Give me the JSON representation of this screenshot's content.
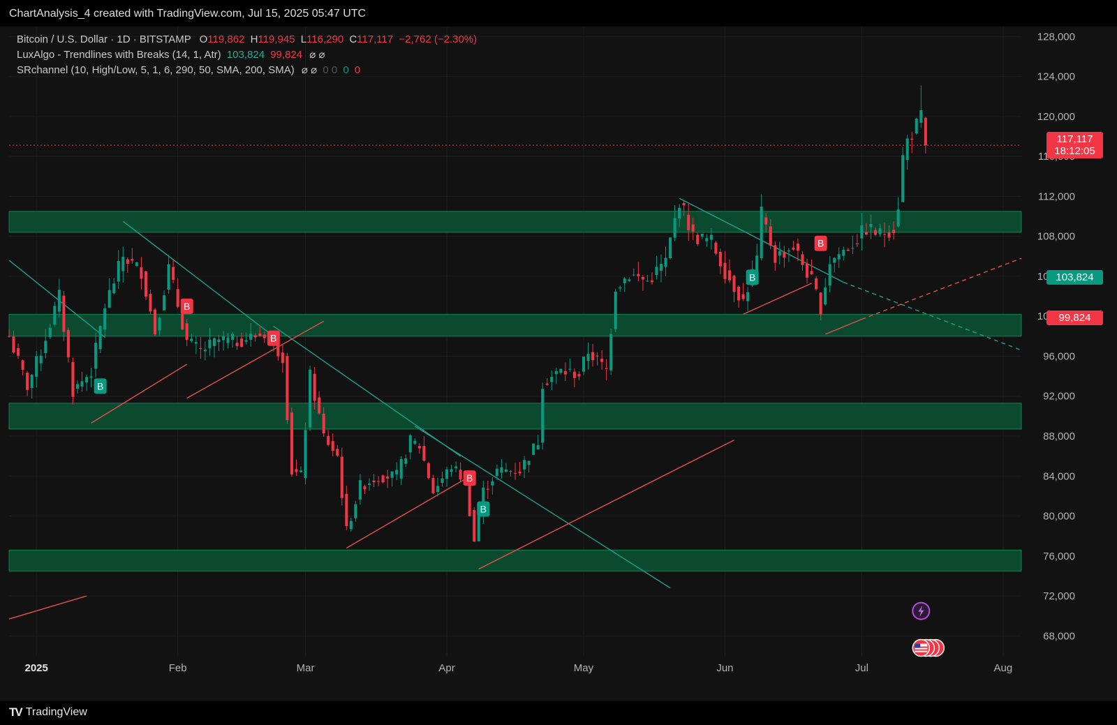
{
  "header": {
    "title": "ChartAnalysis_4 created with TradingView.com, Jul 15, 2025 05:47 UTC"
  },
  "legend": {
    "symbol": "Bitcoin / U.S. Dollar · 1D · BITSTAMP",
    "o_label": "O",
    "o_value": "119,862",
    "h_label": "H",
    "h_value": "119,945",
    "l_label": "L",
    "l_value": "116,290",
    "c_label": "C",
    "c_value": "117,117",
    "change": "−2,762 (−2.30%)",
    "indicator1_name": "LuxAlgo - Trendlines with Breaks (14, 1, Atr)",
    "indicator1_v1": "103,824",
    "indicator1_v2": "99,824",
    "indicator1_icons": "⌀ ⌀",
    "indicator2_name": "SRchannel (10, High/Low, 5, 1, 6, 290, 50, SMA, 200, SMA)",
    "indicator2_icons": "⌀ ⌀",
    "indicator2_dim": "0 0",
    "indicator2_v1": "0",
    "indicator2_v2": "0"
  },
  "price_tags": {
    "last_price": "117,117",
    "countdown": "18:12:05",
    "upper_trend": "103,824",
    "lower_trend": "99,824"
  },
  "footer": {
    "brand": "TradingView"
  },
  "colors": {
    "up": "#089981",
    "down": "#f23645",
    "zone": "#0b4a2e",
    "zone_border": "#16a36a",
    "trend_down": "#1f9e8e",
    "trend_up": "#e0524d",
    "grid": "#1e1e1e"
  },
  "chart_data": {
    "type": "candlestick",
    "title": "Bitcoin / U.S. Dollar · 1D · BITSTAMP",
    "ylim": [
      66000,
      129000
    ],
    "y_ticks": [
      "128,000",
      "124,000",
      "120,000",
      "116,000",
      "112,000",
      "108,000",
      "104,000",
      "100,000",
      "96,000",
      "92,000",
      "88,000",
      "84,000",
      "80,000",
      "76,000",
      "72,000",
      "68,000"
    ],
    "y_tick_values": [
      128000,
      124000,
      120000,
      116000,
      112000,
      108000,
      104000,
      100000,
      96000,
      92000,
      88000,
      84000,
      80000,
      76000,
      72000,
      68000
    ],
    "x_start_day": "2024-12-26",
    "x_end_day": "2025-08-05",
    "x_ticks": [
      {
        "label": "2025",
        "day": "2025-01-01",
        "bold": true
      },
      {
        "label": "Feb",
        "day": "2025-02-01"
      },
      {
        "label": "Mar",
        "day": "2025-03-01"
      },
      {
        "label": "Apr",
        "day": "2025-04-01"
      },
      {
        "label": "May",
        "day": "2025-05-01"
      },
      {
        "label": "Jun",
        "day": "2025-06-01"
      },
      {
        "label": "Jul",
        "day": "2025-07-01"
      },
      {
        "label": "Aug",
        "day": "2025-08-01"
      }
    ],
    "anchors": [
      [
        "2024-12-26",
        98000
      ],
      [
        "2024-12-30",
        93000
      ],
      [
        "2025-01-02",
        96500
      ],
      [
        "2025-01-06",
        102000
      ],
      [
        "2025-01-09",
        92500
      ],
      [
        "2025-01-13",
        94500
      ],
      [
        "2025-01-16",
        101000
      ],
      [
        "2025-01-20",
        106000
      ],
      [
        "2025-01-24",
        104500
      ],
      [
        "2025-01-27",
        98500
      ],
      [
        "2025-01-30",
        104800
      ],
      [
        "2025-02-03",
        97500
      ],
      [
        "2025-02-06",
        96500
      ],
      [
        "2025-02-10",
        97600
      ],
      [
        "2025-02-14",
        97500
      ],
      [
        "2025-02-20",
        98300
      ],
      [
        "2025-02-24",
        96000
      ],
      [
        "2025-02-26",
        84500
      ],
      [
        "2025-02-28",
        84000
      ],
      [
        "2025-03-02",
        94000
      ],
      [
        "2025-03-05",
        88000
      ],
      [
        "2025-03-08",
        86000
      ],
      [
        "2025-03-10",
        78500
      ],
      [
        "2025-03-13",
        83000
      ],
      [
        "2025-03-17",
        84000
      ],
      [
        "2025-03-21",
        84000
      ],
      [
        "2025-03-24",
        87500
      ],
      [
        "2025-03-26",
        87000
      ],
      [
        "2025-03-29",
        82500
      ],
      [
        "2025-04-02",
        85000
      ],
      [
        "2025-04-05",
        83500
      ],
      [
        "2025-04-07",
        77500
      ],
      [
        "2025-04-09",
        82500
      ],
      [
        "2025-04-12",
        84500
      ],
      [
        "2025-04-17",
        84600
      ],
      [
        "2025-04-21",
        87500
      ],
      [
        "2025-04-22",
        93400
      ],
      [
        "2025-04-26",
        94500
      ],
      [
        "2025-04-30",
        94200
      ],
      [
        "2025-05-02",
        96500
      ],
      [
        "2025-05-06",
        94600
      ],
      [
        "2025-05-08",
        103000
      ],
      [
        "2025-05-11",
        104200
      ],
      [
        "2025-05-15",
        103500
      ],
      [
        "2025-05-19",
        105500
      ],
      [
        "2025-05-21",
        109600
      ],
      [
        "2025-05-22",
        111600
      ],
      [
        "2025-05-25",
        108000
      ],
      [
        "2025-05-29",
        107500
      ],
      [
        "2025-06-01",
        104500
      ],
      [
        "2025-06-05",
        101500
      ],
      [
        "2025-06-08",
        105700
      ],
      [
        "2025-06-09",
        110200
      ],
      [
        "2025-06-12",
        105900
      ],
      [
        "2025-06-16",
        107000
      ],
      [
        "2025-06-20",
        103500
      ],
      [
        "2025-06-22",
        100900
      ],
      [
        "2025-06-24",
        105500
      ],
      [
        "2025-06-29",
        107300
      ],
      [
        "2025-07-02",
        108800
      ],
      [
        "2025-07-05",
        108200
      ],
      [
        "2025-07-08",
        108900
      ],
      [
        "2025-07-09",
        111200
      ],
      [
        "2025-07-10",
        115900
      ],
      [
        "2025-07-11",
        117600
      ],
      [
        "2025-07-13",
        119100
      ],
      [
        "2025-07-14",
        119862
      ],
      [
        "2025-07-15",
        117117
      ]
    ],
    "last_candle": {
      "day": "2025-07-15",
      "open": 119862,
      "high": 119945,
      "low": 116290,
      "close": 117117
    },
    "spike_highs": [
      [
        "2025-07-14",
        123100
      ]
    ],
    "zones": [
      {
        "top": 110500,
        "bottom": 108400
      },
      {
        "top": 100200,
        "bottom": 98000
      },
      {
        "top": 91300,
        "bottom": 88700
      },
      {
        "top": 76600,
        "bottom": 74500
      }
    ],
    "last_price": 117117,
    "trendlines_down": [
      [
        [
          "2024-12-26",
          105600
        ],
        [
          "2025-01-16",
          97900
        ]
      ],
      [
        [
          "2025-01-20",
          109500
        ],
        [
          "2025-02-22",
          98000
        ]
      ],
      [
        [
          "2025-02-22",
          99000
        ],
        [
          "2025-04-04",
          86000
        ]
      ],
      [
        [
          "2025-03-25",
          89000
        ],
        [
          "2025-05-20",
          72800
        ]
      ],
      [
        [
          "2025-05-22",
          111800
        ],
        [
          "2025-06-27",
          103400
        ]
      ]
    ],
    "trendlines_down_dashed": [
      [
        [
          "2025-06-27",
          103400
        ],
        [
          "2025-08-05",
          96600
        ]
      ]
    ],
    "trendlines_up": [
      [
        [
          "2024-12-26",
          69700
        ],
        [
          "2025-01-12",
          72000
        ]
      ],
      [
        [
          "2025-01-13",
          89300
        ],
        [
          "2025-02-03",
          95200
        ]
      ],
      [
        [
          "2025-02-03",
          91800
        ],
        [
          "2025-03-05",
          99500
        ]
      ],
      [
        [
          "2025-03-10",
          76800
        ],
        [
          "2025-04-05",
          83700
        ]
      ],
      [
        [
          "2025-04-08",
          74700
        ],
        [
          "2025-06-03",
          87600
        ]
      ],
      [
        [
          "2025-06-05",
          100200
        ],
        [
          "2025-06-20",
          103300
        ]
      ],
      [
        [
          "2025-06-23",
          98200
        ],
        [
          "2025-07-01",
          99700
        ]
      ]
    ],
    "trendlines_up_dashed": [
      [
        [
          "2025-07-01",
          99700
        ],
        [
          "2025-08-05",
          105800
        ]
      ]
    ],
    "break_markers": [
      {
        "day": "2025-01-15",
        "price": 93000,
        "side": "up",
        "label": "B"
      },
      {
        "day": "2025-02-03",
        "price": 101000,
        "side": "down",
        "label": "B"
      },
      {
        "day": "2025-02-22",
        "price": 97800,
        "side": "down",
        "label": "B"
      },
      {
        "day": "2025-04-06",
        "price": 83800,
        "side": "down",
        "label": "B"
      },
      {
        "day": "2025-04-09",
        "price": 80700,
        "side": "up",
        "label": "B"
      },
      {
        "day": "2025-06-07",
        "price": 103900,
        "side": "up",
        "label": "B"
      },
      {
        "day": "2025-06-22",
        "price": 107300,
        "side": "down",
        "label": "B"
      }
    ],
    "event_icons": [
      "lightning-icon",
      "us-flag-icon"
    ]
  }
}
